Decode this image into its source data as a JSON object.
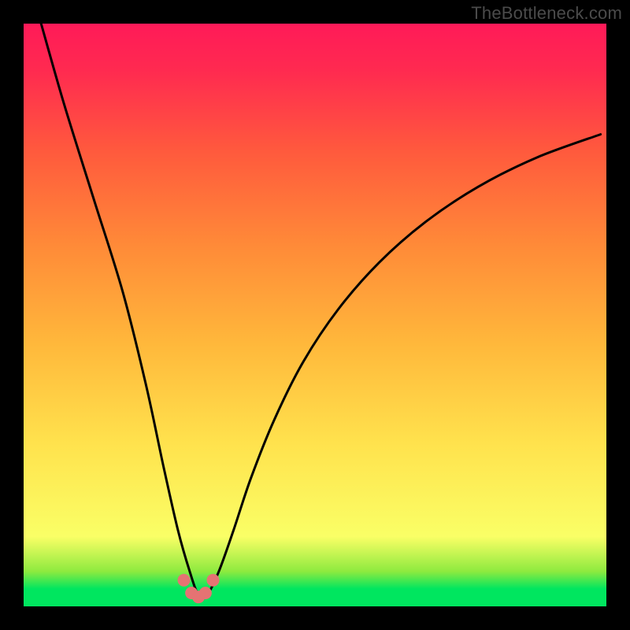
{
  "watermark": "TheBottleneck.com",
  "colors": {
    "frame": "#000000",
    "curve_stroke": "#000000",
    "marker_fill": "#e57373",
    "marker_stroke": "#c24d4d",
    "gradient_stops": [
      "#00e65f",
      "#8eea3f",
      "#faff66",
      "#ffe24d",
      "#ffb83b",
      "#ff8a38",
      "#ff5a3d",
      "#ff2a50",
      "#ff1a58"
    ]
  },
  "chart_data": {
    "type": "line",
    "title": "",
    "xlabel": "",
    "ylabel": "",
    "xlim": [
      0,
      100
    ],
    "ylim": [
      0,
      100
    ],
    "grid": false,
    "legend": false,
    "series": [
      {
        "name": "bottleneck-curve",
        "x": [
          3,
          7,
          12,
          17,
          21,
          24,
          26.5,
          28.5,
          30,
          31.5,
          33.5,
          36,
          39,
          43,
          48,
          54,
          61,
          69,
          78,
          88,
          99
        ],
        "y": [
          100,
          86,
          70,
          54,
          38,
          24,
          13,
          6,
          2,
          2,
          6,
          13,
          22,
          32,
          42,
          51,
          59,
          66,
          72,
          77,
          81
        ]
      }
    ],
    "markers": {
      "name": "valley-points",
      "x": [
        27.5,
        28.8,
        30.0,
        31.2,
        32.5
      ],
      "y": [
        4.5,
        2.3,
        1.6,
        2.3,
        4.5
      ]
    }
  }
}
